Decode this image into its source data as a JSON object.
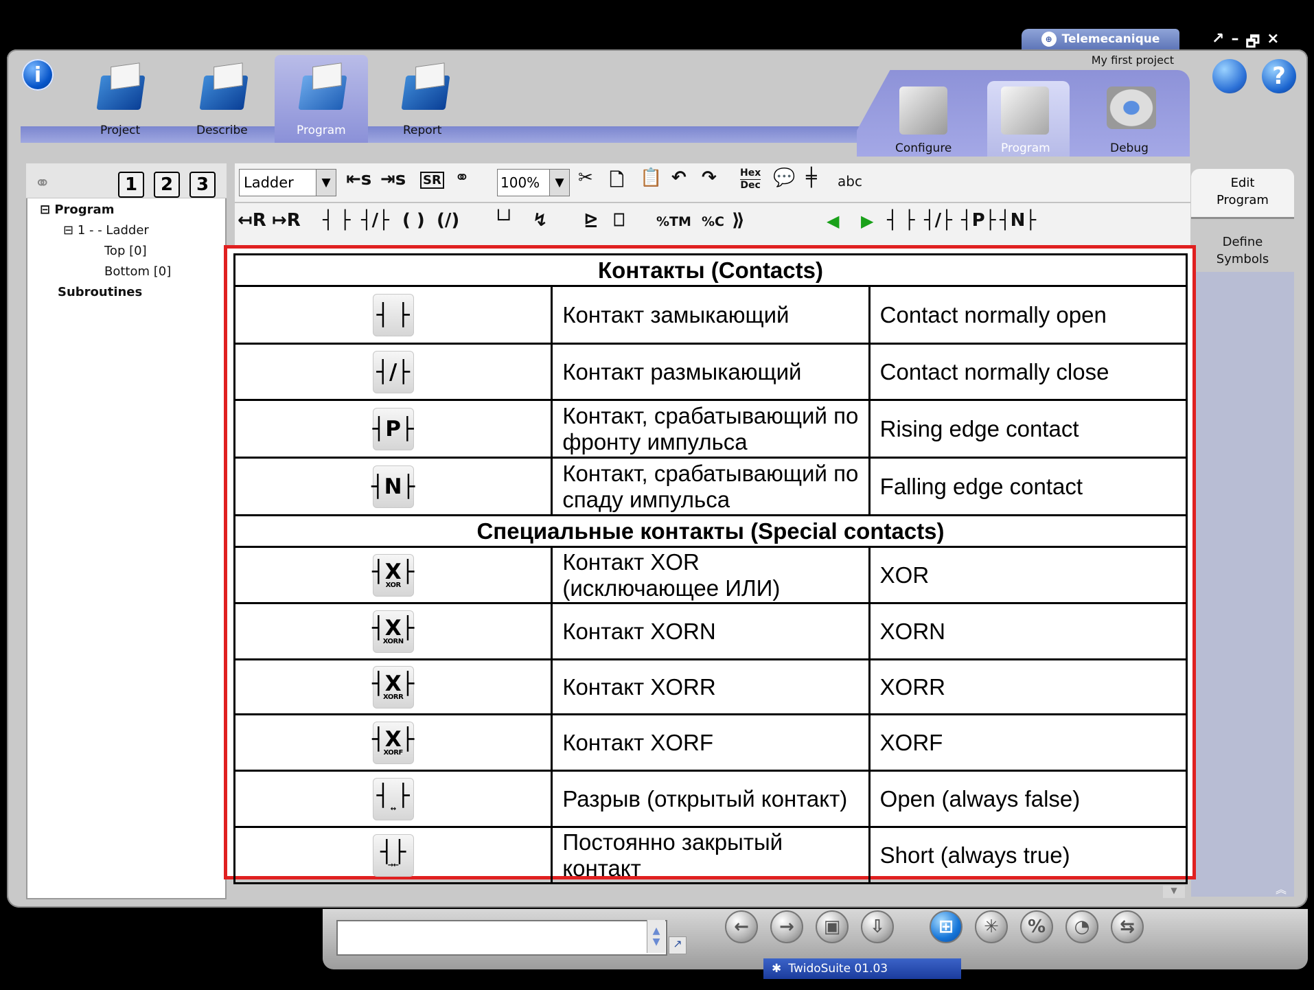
{
  "window": {
    "brand": "Telemecanique",
    "project_name": "My first project",
    "controls": [
      "↗",
      "–",
      "🗗",
      "×"
    ]
  },
  "nav": {
    "tabs": [
      {
        "label": "Project"
      },
      {
        "label": "Describe"
      },
      {
        "label": "Program"
      },
      {
        "label": "Report"
      }
    ],
    "modes": [
      {
        "label": "Configure"
      },
      {
        "label": "Program"
      },
      {
        "label": "Debug"
      }
    ]
  },
  "left_panel": {
    "numbers": [
      "1",
      "2",
      "3"
    ],
    "tree": [
      "Program",
      "1 -  - Ladder",
      "Top [0]",
      "Bottom [0]",
      "Subroutines"
    ]
  },
  "toolbar": {
    "language": "Ladder",
    "zoom": "100%",
    "hex_top": "Hex",
    "hex_bottom": "Dec",
    "row1_icons": [
      "⇤s",
      "⇥s",
      "SR",
      "⚭",
      "✂",
      "🗋",
      "📋",
      "↶",
      "↷",
      "💬",
      "╪",
      "abc"
    ],
    "row2_icons": [
      "↤R",
      "↦R",
      "┤ ├",
      "┤/├",
      "( )",
      "(/)",
      "└┘",
      "↯",
      "⊵",
      "⎕",
      "%TM",
      "%C",
      "⟫",
      "◀",
      "▶",
      "┤ ├",
      "┤/├",
      "┤P├",
      "┤N├"
    ]
  },
  "right_tabs": {
    "edit_program": "Edit\nProgram",
    "define_symbols": "Define\nSymbols"
  },
  "content": {
    "header_contacts": "Контакты (Contacts)",
    "rows_contacts": [
      {
        "icon": "┤ ├",
        "ru": "Контакт замыкающий",
        "en": "Contact normally open"
      },
      {
        "icon": "┤/├",
        "ru": "Контакт размыкающий",
        "en": "Contact normally close"
      },
      {
        "icon": "┤P├",
        "ru": "Контакт, срабатывающий по фронту импульса",
        "en": "Rising edge contact"
      },
      {
        "icon": "┤N├",
        "ru": "Контакт, срабатывающий по спаду импульса",
        "en": "Falling edge contact"
      }
    ],
    "header_special": "Специальные контакты (Special contacts)",
    "rows_special": [
      {
        "icon": "┤X├",
        "sub": "XOR",
        "ru": "Контакт XOR (исключающее ИЛИ)",
        "en": "XOR"
      },
      {
        "icon": "┤X├",
        "sub": "XORN",
        "ru": "Контакт XORN",
        "en": "XORN"
      },
      {
        "icon": "┤X├",
        "sub": "XORR",
        "ru": "Контакт XORR",
        "en": "XORR"
      },
      {
        "icon": "┤X├",
        "sub": "XORF",
        "ru": "Контакт XORF",
        "en": "XORF"
      },
      {
        "icon": "┤ ├",
        "sub": "↔",
        "ru": "Разрыв (открытый контакт)",
        "en": "Open (always false)"
      },
      {
        "icon": "┤├",
        "sub": "→←",
        "ru": "Постоянно закрытый контакт",
        "en": "Short (always true)"
      }
    ]
  },
  "footer": {
    "version": "TwidoSuite 01.03"
  },
  "colors": {
    "highlight_border": "#e02020",
    "nav_blue": "#8b91d8",
    "version_bar": "#1b3c9d"
  }
}
